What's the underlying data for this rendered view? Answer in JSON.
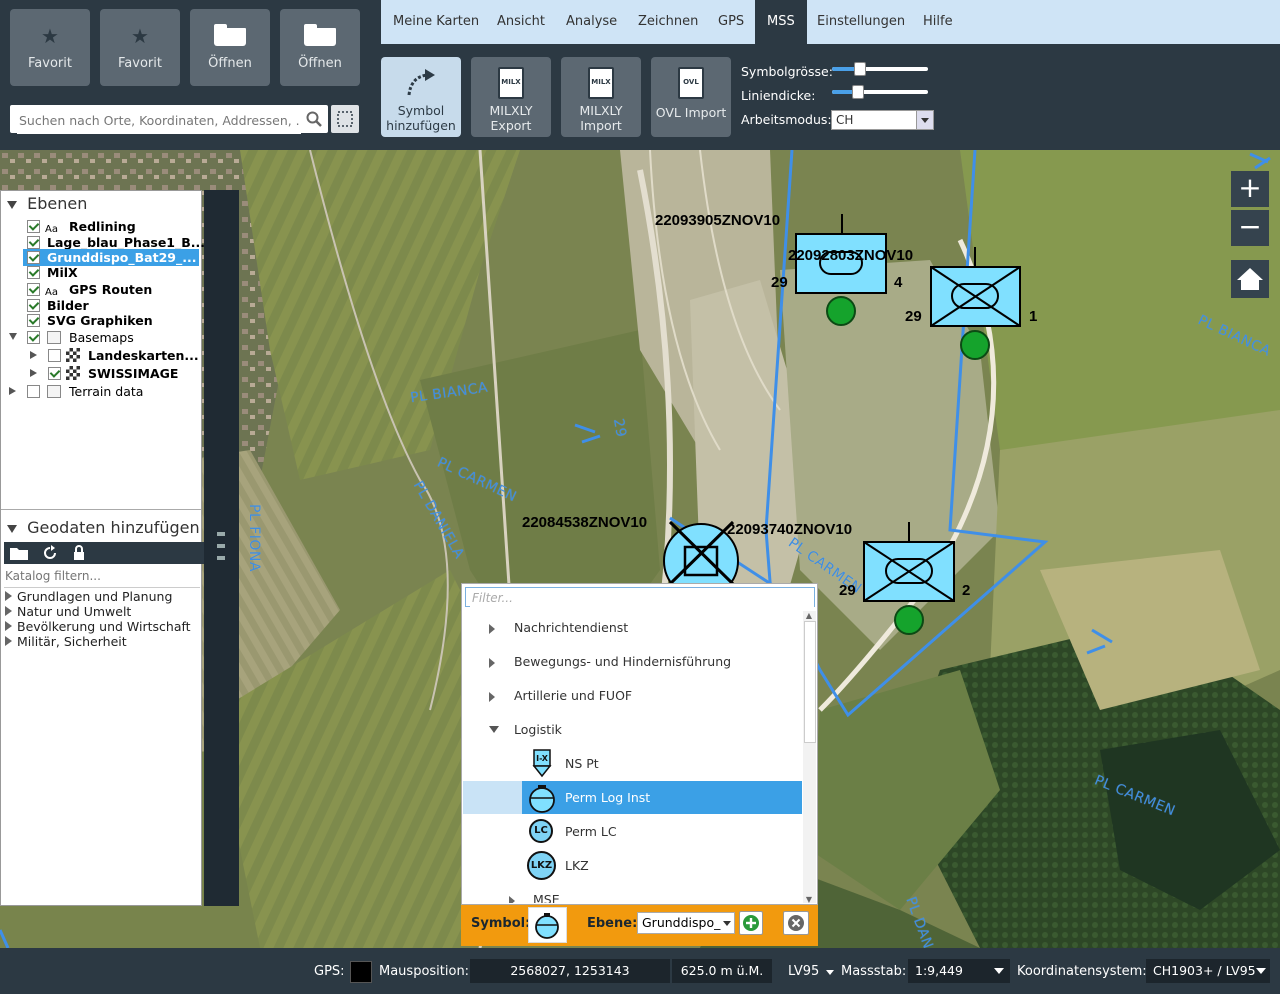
{
  "favorites": [
    {
      "label": "Favorit",
      "icon": "star-icon"
    },
    {
      "label": "Favorit",
      "icon": "star-icon"
    },
    {
      "label": "Öffnen",
      "icon": "folder-icon"
    },
    {
      "label": "Öffnen",
      "icon": "folder-icon"
    }
  ],
  "search": {
    "placeholder": "Suchen nach Orte, Koordinaten, Addressen, ..."
  },
  "menu": [
    "Meine Karten",
    "Ansicht",
    "Analyse",
    "Zeichnen",
    "GPS",
    "MSS",
    "Einstellungen",
    "Hilfe"
  ],
  "menu_active": "MSS",
  "tools": [
    {
      "label1": "Symbol",
      "label2": "hinzufügen",
      "tag": ""
    },
    {
      "label1": "MILXLY",
      "label2": "Export",
      "tag": "MILX"
    },
    {
      "label1": "MILXLY",
      "label2": "Import",
      "tag": "MILX"
    },
    {
      "label1": "OVL Import",
      "label2": "",
      "tag": "OVL"
    }
  ],
  "settings": {
    "symbol_size_label": "Symbolgrösse:",
    "symbol_size_value": 0.28,
    "line_width_label": "Liniendicke:",
    "line_width_value": 0.26,
    "mode_label": "Arbeitsmodus:",
    "mode_value": "CH"
  },
  "layers": {
    "title": "Ebenen",
    "items": [
      {
        "label": "Redlining",
        "checked": true,
        "bold": true,
        "icon": "Aa"
      },
      {
        "label": "Lage_blau_Phase1_B...",
        "checked": true,
        "bold": true
      },
      {
        "label": "Grunddispo_Bat29_...",
        "checked": true,
        "bold": true,
        "selected": true
      },
      {
        "label": "MilX",
        "checked": true,
        "bold": true
      },
      {
        "label": "GPS Routen",
        "checked": true,
        "bold": true,
        "icon": "Aa"
      },
      {
        "label": "Bilder",
        "checked": true,
        "bold": true
      },
      {
        "label": "SVG Graphiken",
        "checked": true,
        "bold": true
      },
      {
        "label": "Basemaps",
        "checked": true,
        "bold": false
      },
      {
        "label": "Landeskarten...",
        "checked": false,
        "bold": true
      },
      {
        "label": "SWISSIMAGE",
        "checked": true,
        "bold": true
      },
      {
        "label": "Terrain data",
        "checked": false,
        "bold": false
      }
    ]
  },
  "geodata": {
    "title": "Geodaten hinzufügen",
    "filter_placeholder": "Katalog filtern...",
    "categories": [
      "Grundlagen und Planung",
      "Natur und Umwelt",
      "Bevölkerung und Wirtschaft",
      "Militär, Sicherheit"
    ]
  },
  "map": {
    "labels": [
      "PL BIANCA",
      "PL CARMEN",
      "PL DANIELA",
      "PL FIONA",
      "PL BIANCA",
      "PL CARMEN",
      "PL CARMEN",
      "PL DAN",
      "29",
      "PL BIANCA",
      "PL DANIELA"
    ],
    "dtg": [
      "22093905ZNOV10",
      "22092803ZNOV10",
      "22084538ZNOV10",
      "22093740ZNOV10"
    ],
    "unit_numbers": [
      "29",
      "4",
      "29",
      "1",
      "29",
      "2"
    ]
  },
  "picker": {
    "filter_placeholder": "Filter...",
    "rows": [
      {
        "label": "Nachrichtendienst",
        "type": "group"
      },
      {
        "label": "Bewegungs- und Hindernisführung",
        "type": "group"
      },
      {
        "label": "Artillerie und FUOF",
        "type": "group"
      },
      {
        "label": "Logistik",
        "type": "group-open"
      },
      {
        "label": "NS Pt",
        "type": "item",
        "symbol": "I-X"
      },
      {
        "label": "Perm Log Inst",
        "type": "item",
        "selected": true,
        "symbol": ""
      },
      {
        "label": "Perm LC",
        "type": "item",
        "symbol": "LC"
      },
      {
        "label": "LKZ",
        "type": "item",
        "symbol": "LKZ"
      },
      {
        "label": "MSE",
        "type": "group"
      }
    ],
    "symbol_label": "Symbol:",
    "layer_label": "Ebene:",
    "layer_value": "Grunddispo_"
  },
  "status": {
    "gps_label": "GPS:",
    "mouse_label": "Mausposition:",
    "mouse_value": "2568027, 1253143",
    "height_value": "625.0 m ü.M.",
    "proj_value": "LV95",
    "scale_label": "Massstab:",
    "scale_value": "1:9,449",
    "crs_label": "Koordinatensystem:",
    "crs_value": "CH1903+ / LV95"
  },
  "colors": {
    "accent": "#3ba0e6",
    "toolbar": "#2c3943",
    "menubar": "#cfe4f6",
    "picker_bar": "#f29a0e",
    "friendly": "#80e0ff"
  }
}
